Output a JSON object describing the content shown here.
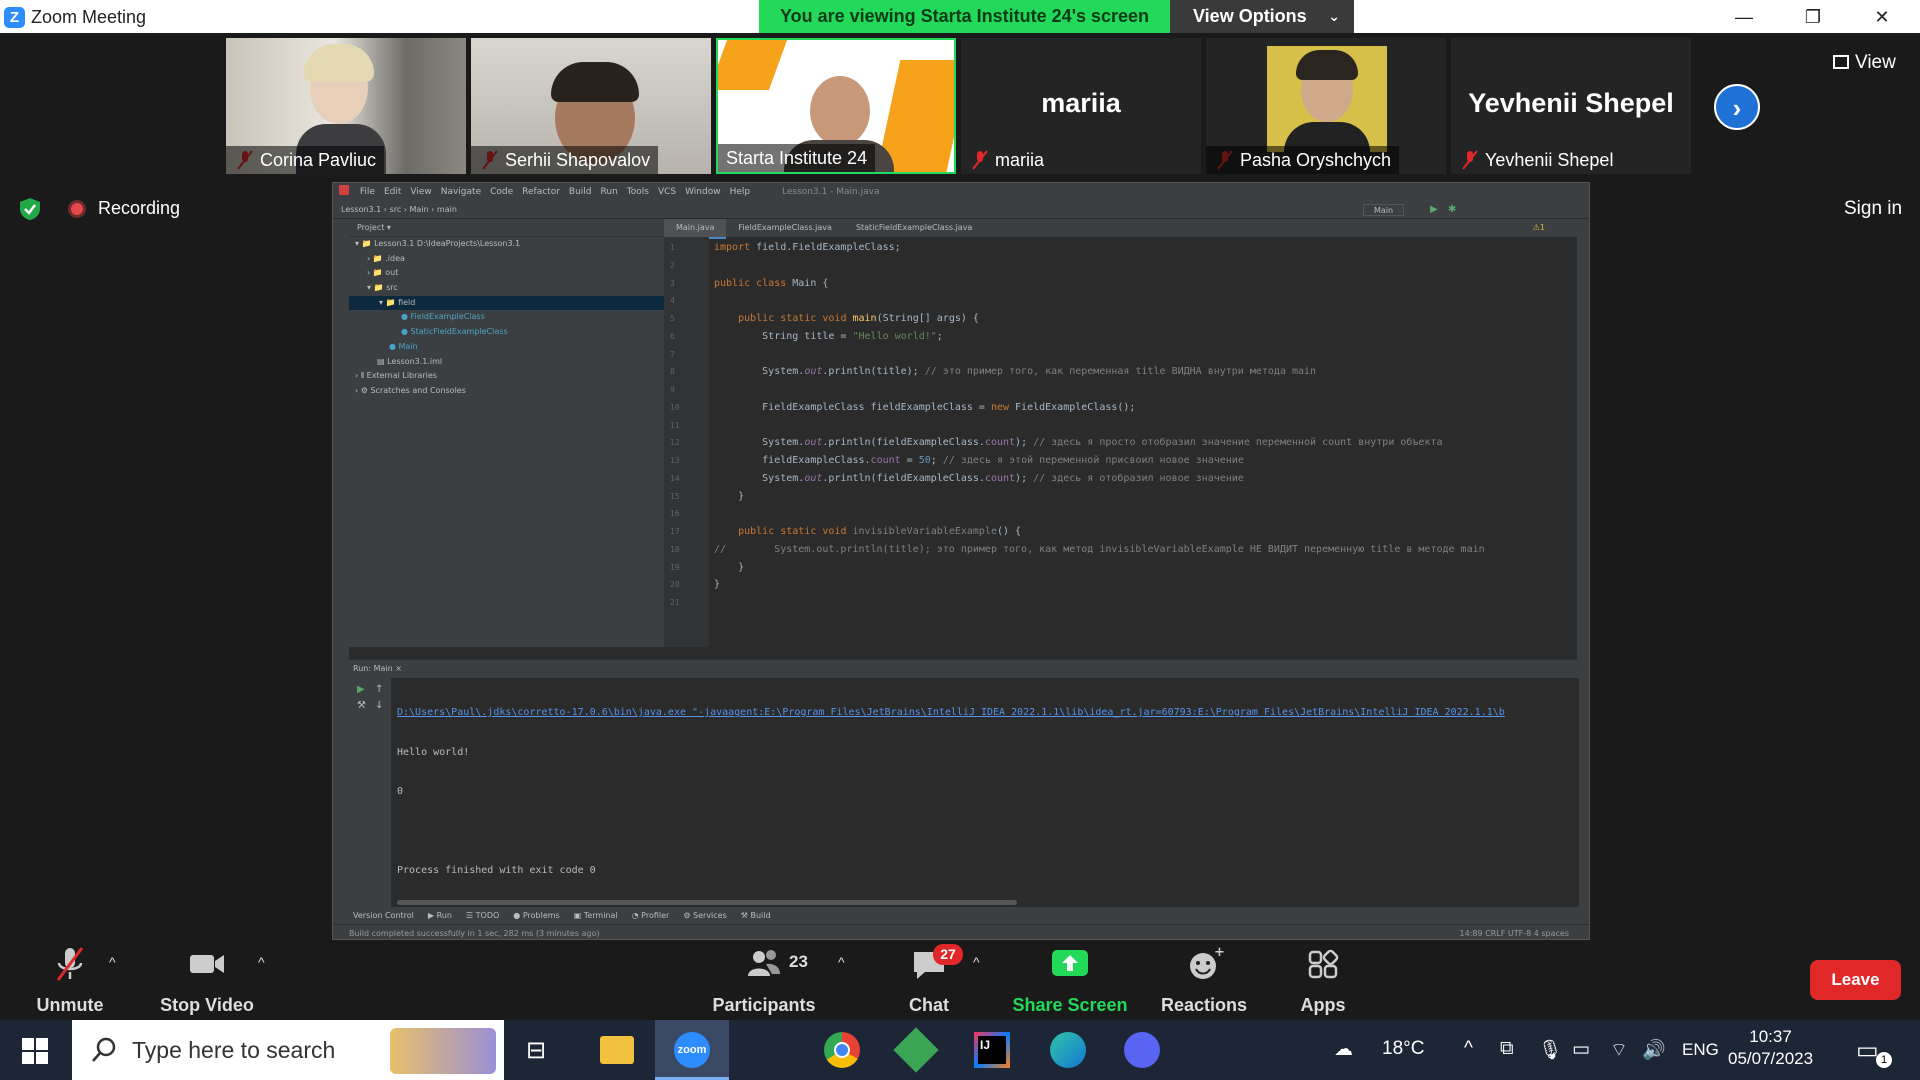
{
  "window": {
    "title": "Zoom Meeting",
    "minimize": "—",
    "restore": "❐",
    "close": "✕"
  },
  "banner": {
    "viewing": "You are viewing Starta Institute 24's screen",
    "view_options": "View Options",
    "chevron": "⌄"
  },
  "participants_strip": [
    {
      "name": "Corina Pavliuc",
      "type": "video"
    },
    {
      "name": "Serhii Shapovalov",
      "type": "video"
    },
    {
      "name": "Starta Institute 24",
      "type": "video",
      "active": true
    },
    {
      "name": "mariia",
      "type": "name",
      "big": "mariia"
    },
    {
      "name": "Pasha Oryshchych",
      "type": "video"
    },
    {
      "name": "Yevhenii Shepel",
      "type": "name",
      "big": "Yevhenii Shepel"
    }
  ],
  "view_label": "View",
  "next_icon": "›",
  "recording_label": "Recording",
  "sign_in": "Sign in",
  "ide": {
    "menu": [
      "File",
      "Edit",
      "View",
      "Navigate",
      "Code",
      "Refactor",
      "Build",
      "Run",
      "Tools",
      "VCS",
      "Window",
      "Help",
      "Lesson3.1 - Main.java"
    ],
    "breadcrumb": "Lesson3.1 › src › Main › main",
    "run_config": "Main",
    "project_header": "Project ▾",
    "tree": [
      {
        "indent": 0,
        "label": "▾ 📁 Lesson3.1  D:\\IdeaProjects\\Lesson3.1"
      },
      {
        "indent": 1,
        "label": "› 📁 .idea"
      },
      {
        "indent": 1,
        "label": "› 📁 out"
      },
      {
        "indent": 1,
        "label": "▾ 📁 src"
      },
      {
        "indent": 2,
        "label": "▾ 📁 field",
        "selected": true
      },
      {
        "indent": 3,
        "label": "● FieldExampleClass"
      },
      {
        "indent": 3,
        "label": "● StaticFieldExampleClass"
      },
      {
        "indent": 2,
        "label": "● Main"
      },
      {
        "indent": 1,
        "label": "▤ Lesson3.1.iml"
      },
      {
        "indent": 0,
        "label": "› ⫴ External Libraries"
      },
      {
        "indent": 0,
        "label": "› ⚙ Scratches and Consoles"
      }
    ],
    "tabs": [
      "Main.java",
      "FieldExampleClass.java",
      "StaticFieldExampleClass.java"
    ],
    "warning": "⚠1",
    "line_numbers": [
      "1",
      "2",
      "3",
      "4",
      "5",
      "6",
      "7",
      "8",
      "9",
      "10",
      "11",
      "12",
      "13",
      "14",
      "15",
      "16",
      "17",
      "18",
      "19",
      "20",
      "21"
    ],
    "code": [
      "<span class='kw'>import</span> field.FieldExampleClass;",
      "",
      "<span class='kw'>public class</span> Main {",
      "",
      "    <span class='kw'>public static void</span> <span class='fn'>main</span>(String[] args) {",
      "        String title = <span class='str'>\"Hello world!\"</span>;",
      "",
      "        System.<span class='fld it'>out</span>.println(title); <span class='cm'>// это пример того, как переменная title ВИДНА внутри метода main</span>",
      "",
      "        FieldExampleClass fieldExampleClass = <span class='kw'>new</span> FieldExampleClass();",
      "",
      "        System.<span class='fld it'>out</span>.println(fieldExampleClass.<span class='fld'>count</span>); <span class='cm'>// здесь я просто отобразил значение переменной count внутри объекта</span>",
      "        fieldExampleClass.<span class='fld'>count</span> = <span class='num'>50</span>; <span class='cm'>// здесь я этой переменной присвоил новое значение</span>",
      "        System.<span class='fld it'>out</span>.println(fieldExampleClass.<span class='fld'>count</span>); <span class='cm'>// здесь я отобразил новое значение</span>",
      "    }",
      "",
      "    <span class='kw'>public static void</span> <span style='color:#808080'>invisibleVariableExample</span>() {",
      "<span class='cm'>//        System.out.println(title); это пример того, как метод invisibleVariableExample НЕ ВИДИТ переменную title в методе main</span>",
      "    }",
      "}",
      ""
    ],
    "run_header": "Run:   Main ×",
    "run_output": [
      "D:\\Users\\Paul\\.jdks\\corretto-17.0.6\\bin\\java.exe \"-javaagent:E:\\Program Files\\JetBrains\\IntelliJ IDEA 2022.1.1\\lib\\idea_rt.jar=60793:E:\\Program Files\\JetBrains\\IntelliJ IDEA 2022.1.1\\b",
      "Hello world!",
      "0",
      "",
      "Process finished with exit code 0"
    ],
    "bottom_tabs": [
      "Version Control",
      "▶ Run",
      "☰ TODO",
      "● Problems",
      "▣ Terminal",
      "◔ Profiler",
      "⚙ Services",
      "⚒ Build"
    ],
    "status_left": "Build completed successfully in 1 sec, 282 ms (3 minutes ago)",
    "status_right": "14:89  CRLF  UTF-8  4 spaces"
  },
  "toolbar": {
    "unmute": "Unmute",
    "stop_video": "Stop Video",
    "participants": "Participants",
    "participants_count": "23",
    "chat": "Chat",
    "chat_badge": "27",
    "share_screen": "Share Screen",
    "reactions": "Reactions",
    "apps": "Apps",
    "leave": "Leave"
  },
  "taskbar": {
    "search_placeholder": "Type here to search",
    "weather": "18°C",
    "lang": "ENG",
    "time": "10:37",
    "date": "05/07/2023",
    "notif_count": "1"
  },
  "colors": {
    "zoom_green": "#23d959",
    "leave_red": "#e02828",
    "zoom_blue": "#2d8cff"
  }
}
